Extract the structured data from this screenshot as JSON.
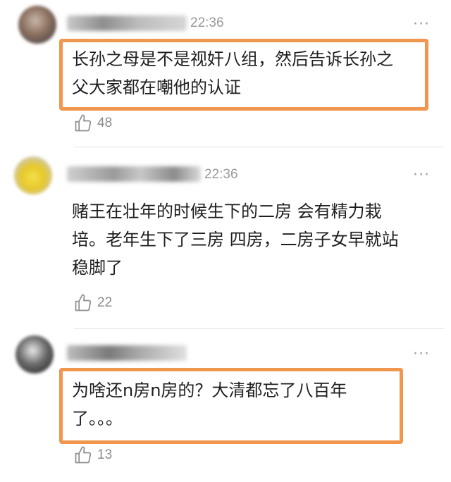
{
  "comments": [
    {
      "time": "22:36",
      "text": "长孙之母是不是视奸八组，然后告诉长孙之父大家都在嘲他的认证",
      "line1": "长孙之母是不是视奸八组，然后告诉长孙之",
      "line2": "父大家都在嘲他的认证",
      "likes": "48",
      "highlighted": true
    },
    {
      "time": "22:36",
      "line1": "赌王在壮年的时候生下的二房 会有精力栽",
      "line2": "培。老年生下了三房 四房，二房子女早就站",
      "line3": "稳脚了",
      "likes": "22",
      "highlighted": false
    },
    {
      "time": "",
      "line1": "为啥还n房n房的？大清都忘了八百年",
      "line2": "了。。。",
      "likes": "13",
      "highlighted": true
    }
  ],
  "icons": {
    "like": "thumbs-up-icon",
    "more": "more-dots-icon"
  },
  "colors": {
    "highlight_border": "#f0964d",
    "meta_gray": "#9a9a9a"
  }
}
